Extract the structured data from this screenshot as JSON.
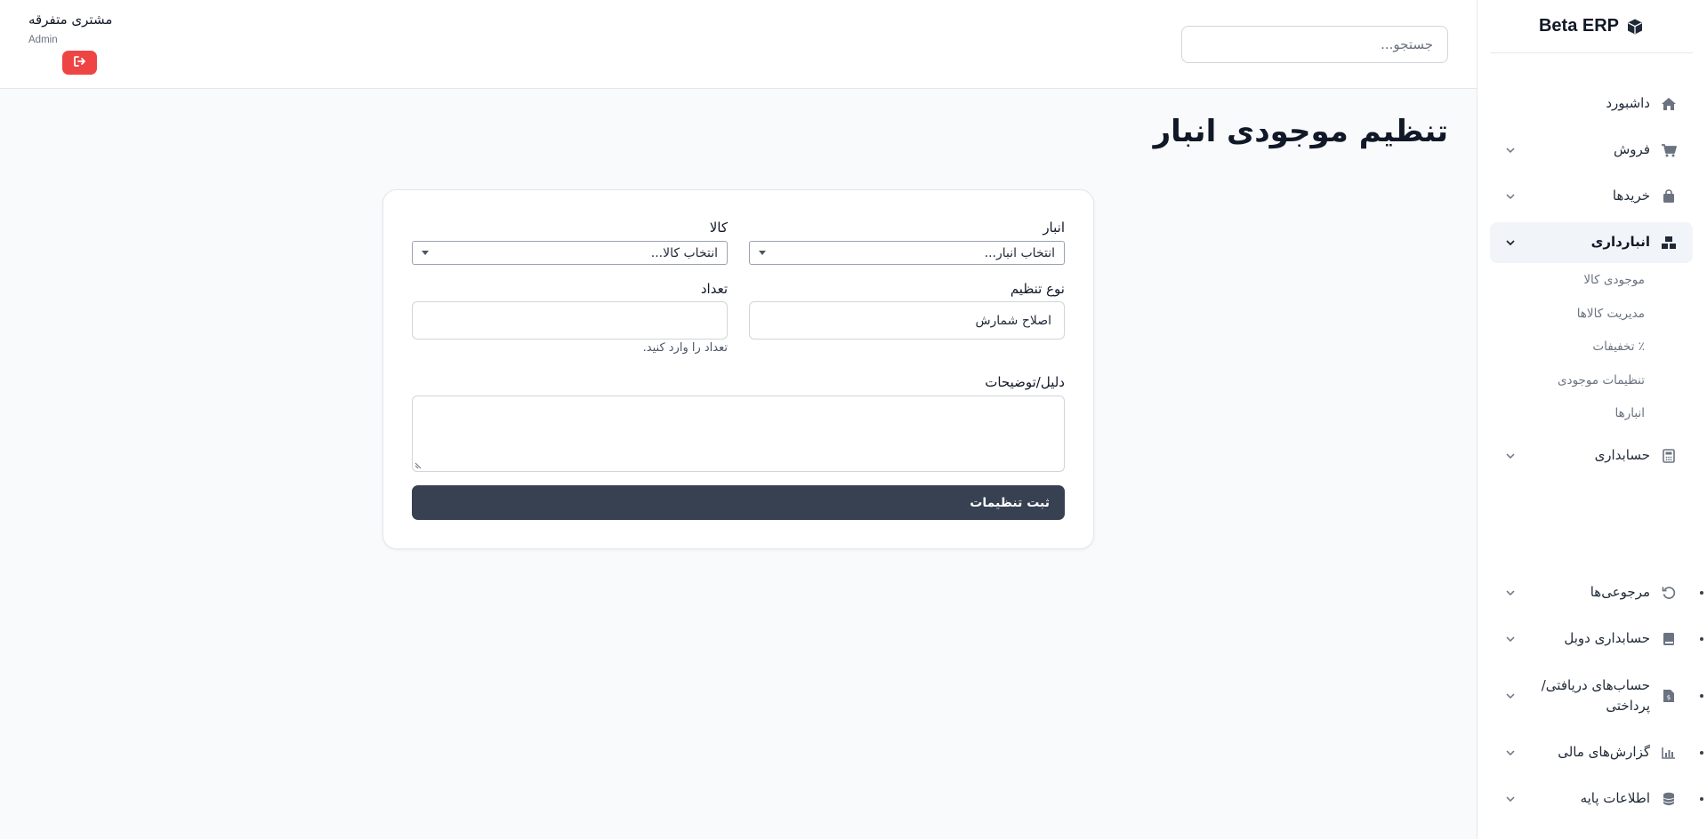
{
  "brand": {
    "name": "Beta ERP",
    "icon": "cube-icon"
  },
  "sidebar": {
    "items": [
      {
        "label": "داشبورد",
        "icon": "home-icon"
      },
      {
        "label": "فروش",
        "icon": "cart-icon"
      },
      {
        "label": "خریدها",
        "icon": "bag-icon"
      },
      {
        "label": "انبارداری",
        "icon": "boxes-icon",
        "active": true
      },
      {
        "label": "حسابداری",
        "icon": "calculator-icon"
      },
      {
        "label": "مرجوعی‌ها",
        "icon": "undo-icon"
      },
      {
        "label": "حسابداری دوبل",
        "icon": "book-icon"
      },
      {
        "label": "حساب‌های دریافتی/پرداختی",
        "icon": "invoice-icon"
      },
      {
        "label": "گزارش‌های مالی",
        "icon": "chart-icon"
      },
      {
        "label": "اطلاعات پایه",
        "icon": "database-icon"
      }
    ],
    "subitems": [
      {
        "label": "موجودی کالا"
      },
      {
        "label": "مدیریت کالاها"
      },
      {
        "label": "٪ تخفیفات"
      },
      {
        "label": "تنظیمات موجودی"
      },
      {
        "label": "انبارها"
      }
    ]
  },
  "header": {
    "search_placeholder": "جستجو...",
    "user_name": "مشتری متفرقه",
    "user_role": "Admin",
    "logout_icon": "logout-icon"
  },
  "page": {
    "title": "تنظیم موجودی انبار"
  },
  "form": {
    "warehouse_label": "انبار",
    "warehouse_value": "انتخاب انبار...",
    "product_label": "کالا",
    "product_value": "انتخاب کالا...",
    "adjustment_type_label": "نوع تنظیم",
    "adjustment_type_value": "اصلاح شمارش",
    "quantity_label": "تعداد",
    "quantity_value": "",
    "quantity_hint": "تعداد را وارد کنید.",
    "reason_label": "دلیل/توضیحات",
    "reason_value": "",
    "submit_label": "ثبت تنظیمات"
  },
  "colors": {
    "accent_dark": "#374151",
    "danger": "#ef4444",
    "active_bg": "#f1f5f9"
  }
}
